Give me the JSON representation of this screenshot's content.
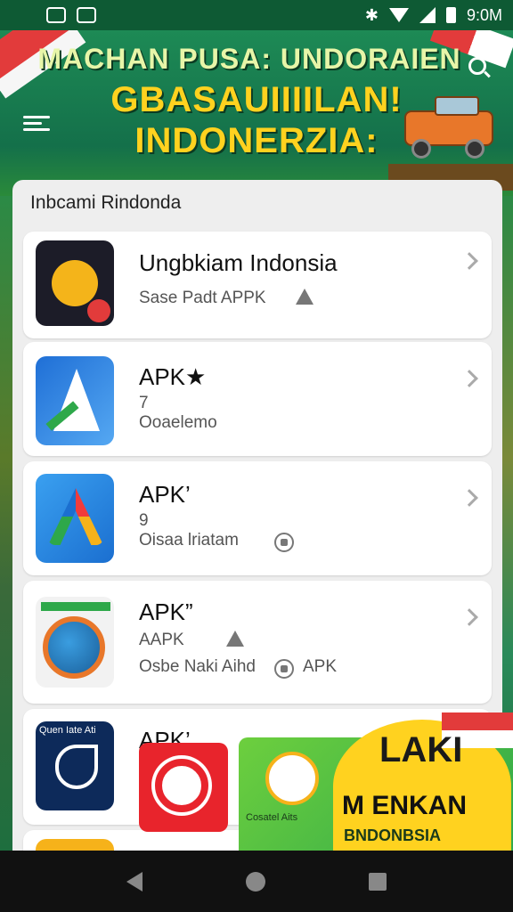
{
  "status_bar": {
    "time": "9:0M"
  },
  "banner": {
    "line1": "MACHAN PUSA: UNDORAIEN",
    "line2": "GBASAUIIIILAN!",
    "line3": "INDONERZIA:"
  },
  "panel": {
    "title": "Inbcami Rindonda"
  },
  "apps": [
    {
      "name": "Ungbkiam Indonsia",
      "sub1": "Sase Padt APPK",
      "sub2": ""
    },
    {
      "name": "APK★",
      "sub1": "7",
      "sub2": "Ooaelemo"
    },
    {
      "name": "APK’",
      "sub1": "9",
      "sub2": "Oisaa lriatam"
    },
    {
      "name": "APK”",
      "sub1": "AAPK",
      "sub2": "Osbe Naki Aihd",
      "sub2b": "APK"
    },
    {
      "name": "APK’"
    }
  ],
  "app5_icon_text": "Quen Iate Ati",
  "promo": {
    "subtitle": "Cosatel Aits",
    "t1": "LAKI",
    "t2": "M ENKAN",
    "t3": "BNDONBSIA"
  },
  "colors": {
    "accent_green": "#1f7a4a",
    "brand_yellow": "#ffd21f",
    "red": "#e23b3b"
  },
  "icons": [
    "bluetooth-icon",
    "wifi-icon",
    "signal-icon",
    "battery-icon",
    "search-icon",
    "menu-icon",
    "chevron-right-icon",
    "back-icon",
    "home-icon",
    "recent-apps-icon"
  ]
}
